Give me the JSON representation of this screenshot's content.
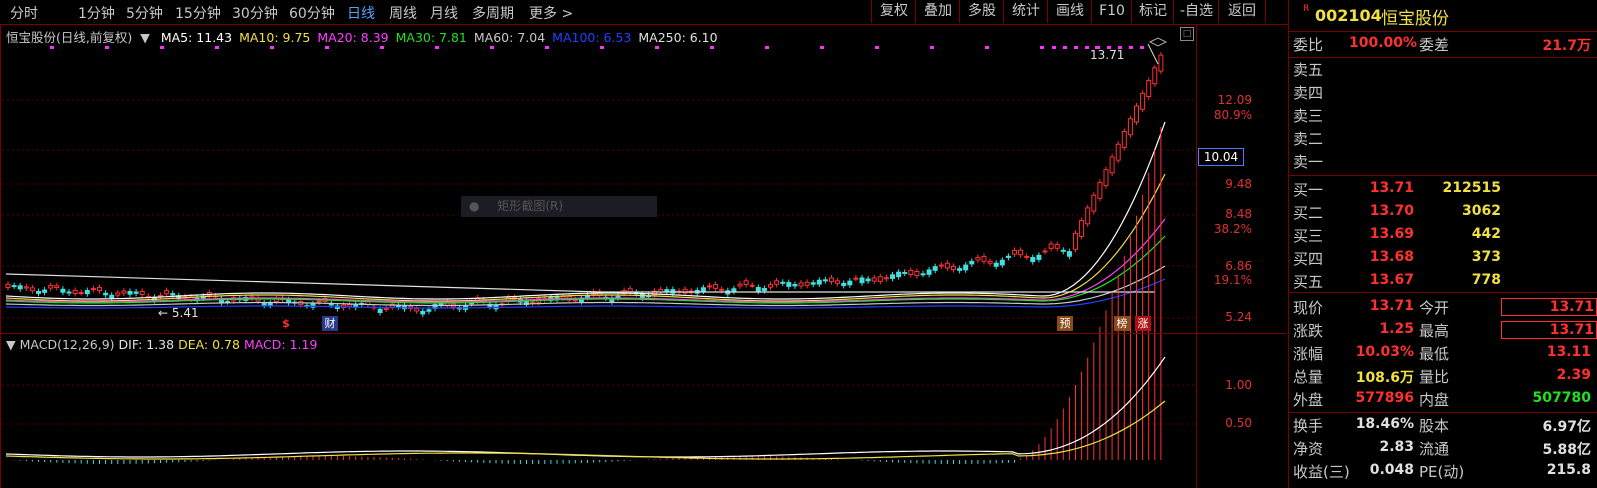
{
  "toolbar": {
    "periods": [
      "分时",
      "1分钟",
      "5分钟",
      "15分钟",
      "30分钟",
      "60分钟",
      "日线",
      "周线",
      "月线",
      "多周期",
      "更多"
    ],
    "active_period": "日线",
    "more_arrow": ">",
    "buttons": [
      "复权",
      "叠加",
      "多股",
      "统计",
      "画线",
      "F10",
      "标记",
      "-自选",
      "返回"
    ]
  },
  "chart": {
    "title": "恒宝股份(日线,前复权)",
    "ma": [
      {
        "label": "MA5: 11.43",
        "color": "#ffffff"
      },
      {
        "label": "MA10: 9.75",
        "color": "#f0e040"
      },
      {
        "label": "MA20: 8.39",
        "color": "#ff40ff"
      },
      {
        "label": "MA30: 7.81",
        "color": "#20e020"
      },
      {
        "label": "MA60: 7.04",
        "color": "#c8c8c8"
      },
      {
        "label": "MA100: 6.53",
        "color": "#2040ff"
      },
      {
        "label": "MA250: 6.10",
        "color": "#e0e0e0"
      }
    ],
    "price_axis": [
      "12.09",
      "80.9%",
      "10.04",
      "9.48",
      "8.48",
      "38.2%",
      "6.86",
      "19.1%",
      "5.24"
    ],
    "current_price_box": "10.04",
    "high_label": "13.71",
    "low_label": "5.41",
    "low_arrow": "←",
    "context_menu_item": "矩形截图(R)",
    "markers": [
      "$",
      "财",
      "预",
      "榜",
      "涨"
    ],
    "macd_title": "MACD(12,26,9)",
    "macd_dif": "DIF: 1.38",
    "macd_dea": "DEA: 0.78",
    "macd_val": "MACD: 1.19",
    "macd_axis": [
      "1.00",
      "0.50"
    ]
  },
  "panel": {
    "flag": "R",
    "code": "002104",
    "name": "恒宝股份",
    "weibi_label": "委比",
    "weibi_val": "100.00%",
    "weicha_label": "委差",
    "weicha_val": "21.7万",
    "sells": [
      {
        "label": "卖五",
        "price": "",
        "vol": ""
      },
      {
        "label": "卖四",
        "price": "",
        "vol": ""
      },
      {
        "label": "卖三",
        "price": "",
        "vol": ""
      },
      {
        "label": "卖二",
        "price": "",
        "vol": ""
      },
      {
        "label": "卖一",
        "price": "",
        "vol": ""
      }
    ],
    "buys": [
      {
        "label": "买一",
        "price": "13.71",
        "vol": "212515"
      },
      {
        "label": "买二",
        "price": "13.70",
        "vol": "3062"
      },
      {
        "label": "买三",
        "price": "13.69",
        "vol": "442"
      },
      {
        "label": "买四",
        "price": "13.68",
        "vol": "373"
      },
      {
        "label": "买五",
        "price": "13.67",
        "vol": "778"
      }
    ],
    "stats": [
      {
        "l1": "现价",
        "v1": "13.71",
        "c1": "red",
        "l2": "今开",
        "v2": "13.71",
        "c2": "red",
        "box": true
      },
      {
        "l1": "涨跌",
        "v1": "1.25",
        "c1": "red",
        "l2": "最高",
        "v2": "13.71",
        "c2": "red",
        "box": true
      },
      {
        "l1": "涨幅",
        "v1": "10.03%",
        "c1": "red",
        "l2": "最低",
        "v2": "13.11",
        "c2": "red"
      },
      {
        "l1": "总量",
        "v1": "108.6万",
        "c1": "yellow",
        "l2": "量比",
        "v2": "2.39",
        "c2": "red"
      },
      {
        "l1": "外盘",
        "v1": "577896",
        "c1": "red",
        "l2": "内盘",
        "v2": "507780",
        "c2": "green"
      }
    ],
    "stats2": [
      {
        "l1": "换手",
        "v1": "18.46%",
        "c1": "white",
        "l2": "股本",
        "v2": "6.97亿",
        "c2": "white"
      },
      {
        "l1": "净资",
        "v1": "2.83",
        "c1": "white",
        "l2": "流通",
        "v2": "5.88亿",
        "c2": "white"
      },
      {
        "l1": "收益(三)",
        "v1": "0.048",
        "c1": "white",
        "l2": "PE(动)",
        "v2": "215.8",
        "c2": "white"
      }
    ]
  }
}
